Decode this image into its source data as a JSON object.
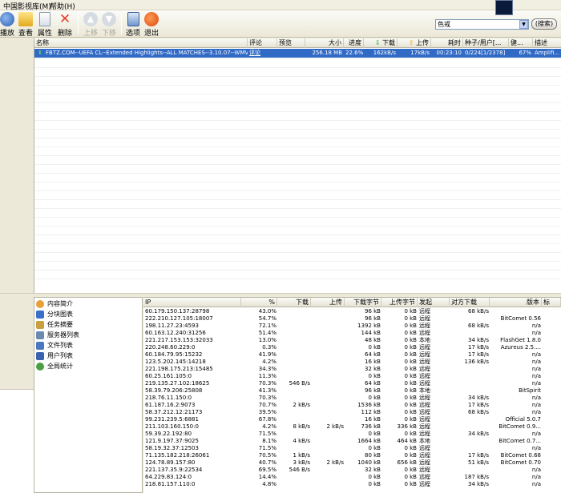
{
  "menu": {
    "items": [
      "中国影视库(M)",
      "帮助(H)"
    ]
  },
  "toolbar": {
    "play": "播放",
    "view": "查看",
    "properties": "属性",
    "delete": "删除",
    "move_up": "上移",
    "move_down": "下移",
    "options": "选项",
    "exit": "退出"
  },
  "search": {
    "value": "色戒",
    "button": "(搜索)"
  },
  "task_list": {
    "columns": [
      "名称",
      "评论",
      "预览",
      "大小",
      "进度",
      "下载",
      "上传",
      "耗时",
      "种子/用户[...",
      "健...",
      "描述"
    ],
    "row": {
      "name": "FBTZ.COM--UEFA CL--Extended Highlights--ALL MATCHES--3.10.07--WMV",
      "comment": "评论",
      "preview": "",
      "size": "256.18 MB",
      "progress": "22.6%",
      "download": "162kB/s",
      "upload": "17kB/s",
      "elapsed": "00:23:10",
      "seeds": "0/224[1/2378]",
      "health": "67%",
      "desc": "Amplifi..."
    }
  },
  "tree": {
    "items": [
      "内容简介",
      "分块图表",
      "任务摘要",
      "服务器列表",
      "文件列表",
      "用户列表",
      "全局统计"
    ]
  },
  "peers": {
    "columns": [
      "IP",
      "%",
      "下载",
      "上传",
      "下载字节",
      "上传字节",
      "发起",
      "对方下载",
      "版本",
      "标"
    ],
    "rows": [
      [
        "60.179.150.137:28798",
        "43.0%",
        "",
        "",
        "96 kB",
        "0 kB",
        "远程",
        "68 kB/s",
        ""
      ],
      [
        "222.210.127.105:18007",
        "54.7%",
        "",
        "",
        "96 kB",
        "0 kB",
        "远程",
        "",
        "BitComet 0.56"
      ],
      [
        "198.11.27.23:4593",
        "72.1%",
        "",
        "",
        "1392 kB",
        "0 kB",
        "远程",
        "68 kB/s",
        "n/a"
      ],
      [
        "60.163.12.240:31256",
        "51.4%",
        "",
        "",
        "144 kB",
        "0 kB",
        "远程",
        "",
        "n/a"
      ],
      [
        "221.217.153.153:32033",
        "13.0%",
        "",
        "",
        "48 kB",
        "0 kB",
        "本地",
        "34 kB/s",
        "FlashGet 1.8.0"
      ],
      [
        "220.248.60.229:0",
        "0.3%",
        "",
        "",
        "0 kB",
        "0 kB",
        "远程",
        "17 kB/s",
        "Azureus 2.5...."
      ],
      [
        "60.184.79.95:15232",
        "41.9%",
        "",
        "",
        "64 kB",
        "0 kB",
        "远程",
        "17 kB/s",
        "n/a"
      ],
      [
        "123.5.202.145:14218",
        "4.2%",
        "",
        "",
        "16 kB",
        "0 kB",
        "远程",
        "136 kB/s",
        "n/a"
      ],
      [
        "221.198.175.213:15485",
        "34.3%",
        "",
        "",
        "32 kB",
        "0 kB",
        "远程",
        "",
        "n/a"
      ],
      [
        "60.25.161.105:0",
        "11.3%",
        "",
        "",
        "0 kB",
        "0 kB",
        "远程",
        "",
        "n/a"
      ],
      [
        "219.135.27.102:18625",
        "70.3%",
        "546 B/s",
        "",
        "64 kB",
        "0 kB",
        "远程",
        "",
        "n/a"
      ],
      [
        "58.39.79.206:25808",
        "41.3%",
        "",
        "",
        "96 kB",
        "0 kB",
        "本地",
        "",
        "BitSpirit"
      ],
      [
        "218.76.11.150:0",
        "70.3%",
        "",
        "",
        "0 kB",
        "0 kB",
        "远程",
        "34 kB/s",
        "n/a"
      ],
      [
        "61.187.16.2:9073",
        "70.7%",
        "2 kB/s",
        "",
        "1536 kB",
        "0 kB",
        "远程",
        "17 kB/s",
        "n/a"
      ],
      [
        "58.37.212.12:21173",
        "39.5%",
        "",
        "",
        "112 kB",
        "0 kB",
        "远程",
        "68 kB/s",
        "n/a"
      ],
      [
        "99.231.239.5:6881",
        "67.8%",
        "",
        "",
        "16 kB",
        "0 kB",
        "远程",
        "",
        "Official 5.0.7"
      ],
      [
        "211.103.160.150:0",
        "4.2%",
        "8 kB/s",
        "2 kB/s",
        "736 kB",
        "336 kB",
        "远程",
        "",
        "BitComet 0.9..."
      ],
      [
        "59.39.22.192:80",
        "71.5%",
        "",
        "",
        "0 kB",
        "0 kB",
        "远程",
        "34 kB/s",
        "n/a"
      ],
      [
        "121.9.197.37:9025",
        "8.1%",
        "4 kB/s",
        "",
        "1664 kB",
        "464 kB",
        "本地",
        "",
        "BitComet 0.7..."
      ],
      [
        "58.19.32.37:12503",
        "71.5%",
        "",
        "",
        "0 kB",
        "0 kB",
        "远程",
        "",
        "n/a"
      ],
      [
        "71.135.182.218:26061",
        "70.5%",
        "1 kB/s",
        "",
        "80 kB",
        "0 kB",
        "远程",
        "17 kB/s",
        "BitComet 0.68"
      ],
      [
        "124.78.89.157:80",
        "40.7%",
        "3 kB/s",
        "2 kB/s",
        "1040 kB",
        "656 kB",
        "远程",
        "51 kB/s",
        "BitComet 0.70"
      ],
      [
        "221.137.35.9:22534",
        "69.5%",
        "546 B/s",
        "",
        "32 kB",
        "0 kB",
        "远程",
        "",
        "n/a"
      ],
      [
        "64.229.83.124:0",
        "14.4%",
        "",
        "",
        "0 kB",
        "0 kB",
        "远程",
        "187 kB/s",
        "n/a"
      ],
      [
        "218.81.157.110:0",
        "4.8%",
        "",
        "",
        "0 kB",
        "0 kB",
        "远程",
        "34 kB/s",
        "n/a"
      ]
    ]
  },
  "colors": {
    "selection": "#316ac5",
    "window_bg": "#ece9d8"
  }
}
